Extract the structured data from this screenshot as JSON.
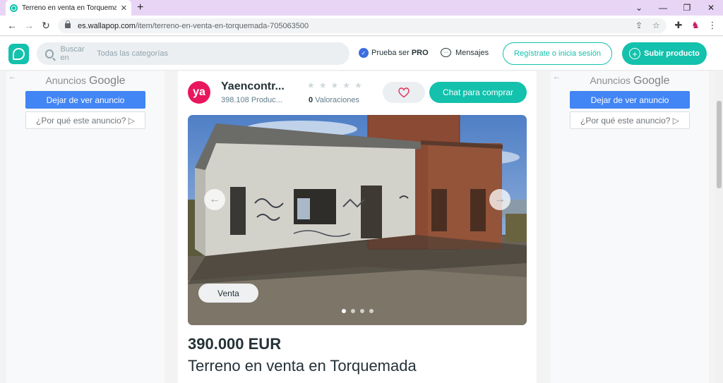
{
  "browser": {
    "tab_title": "Terreno en venta en Torquemada",
    "tab_close": "✕",
    "newtab": "+",
    "url_domain": "es.wallapop.com",
    "url_path": "/item/terreno-en-venta-en-torquemada-705063500"
  },
  "header": {
    "search_prefix": "Buscar en",
    "search_placeholder": "Todas las categorías",
    "pro_label": "Prueba ser",
    "pro_bold": "PRO",
    "messages_label": "Mensajes",
    "login_label": "Regístrate o inicia sesión",
    "upload_label": "Subir producto",
    "accent_color": "#13c1ac"
  },
  "ads": {
    "label_prefix": "Anuncios",
    "label_brand": "Google",
    "stop_label": "Dejar de ver anuncio",
    "why_label": "¿Por qué este anuncio? ▷"
  },
  "seller": {
    "avatar_text": "ya",
    "name": "Yaencontr...",
    "products": "398.108 Produc...",
    "rating_count": "0",
    "rating_label": "Valoraciones",
    "stars": [
      "★",
      "★",
      "★",
      "★",
      "★"
    ]
  },
  "product": {
    "chat_label": "Chat para comprar",
    "badge": "Venta",
    "images_total": 4,
    "active_image": 1,
    "price": "390.000 EUR",
    "title": "Terreno en venta en Torquemada"
  }
}
